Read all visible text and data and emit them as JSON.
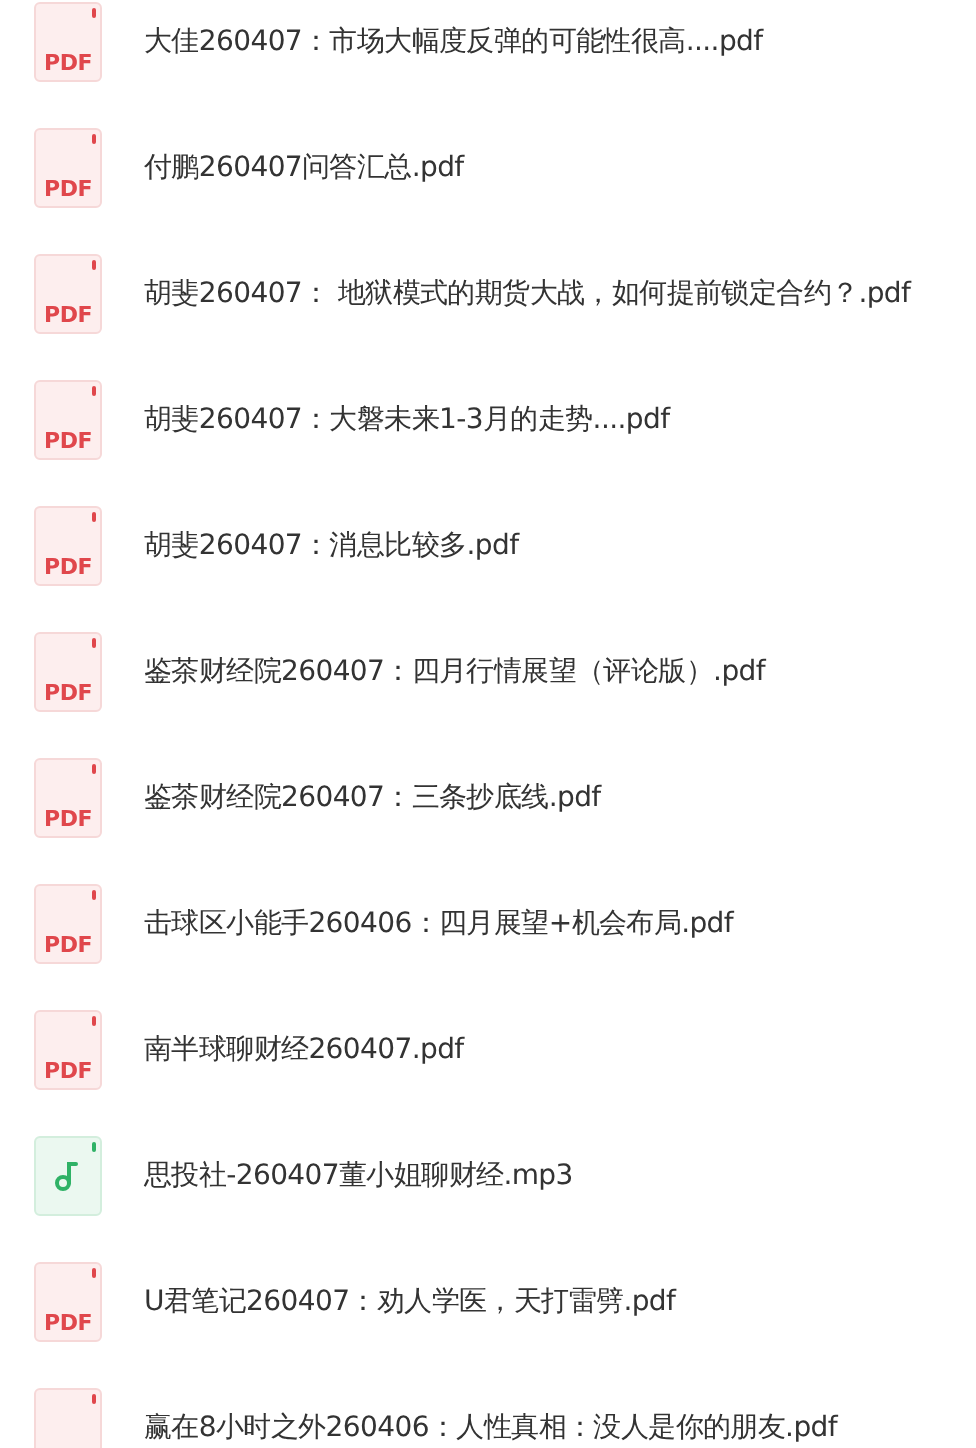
{
  "files": [
    {
      "kind": "pdf",
      "icon_label": "PDF",
      "name": "大佳260407：市场大幅度反弹的可能性很高....pdf"
    },
    {
      "kind": "pdf",
      "icon_label": "PDF",
      "name": "付鹏260407问答汇总.pdf"
    },
    {
      "kind": "pdf",
      "icon_label": "PDF",
      "name": "胡斐260407： 地狱模式的期货大战，如何提前锁定合约？.pdf"
    },
    {
      "kind": "pdf",
      "icon_label": "PDF",
      "name": "胡斐260407：大磐未来1-3月的走势....pdf"
    },
    {
      "kind": "pdf",
      "icon_label": "PDF",
      "name": "胡斐260407：消息比较多.pdf"
    },
    {
      "kind": "pdf",
      "icon_label": "PDF",
      "name": "鉴茶财经院260407：四月行情展望（评论版）.pdf"
    },
    {
      "kind": "pdf",
      "icon_label": "PDF",
      "name": "鉴茶财经院260407：三条抄底线.pdf"
    },
    {
      "kind": "pdf",
      "icon_label": "PDF",
      "name": "击球区小能手260406：四月展望+机会布局.pdf"
    },
    {
      "kind": "pdf",
      "icon_label": "PDF",
      "name": "南半球聊财经260407.pdf"
    },
    {
      "kind": "audio",
      "name": "思投社-260407董小姐聊财经.mp3"
    },
    {
      "kind": "pdf",
      "icon_label": "PDF",
      "name": "U君笔记260407：劝人学医，天打雷劈.pdf"
    },
    {
      "kind": "pdf",
      "name": "赢在8小时之外260406：人性真相：没人是你的朋友.pdf"
    }
  ]
}
